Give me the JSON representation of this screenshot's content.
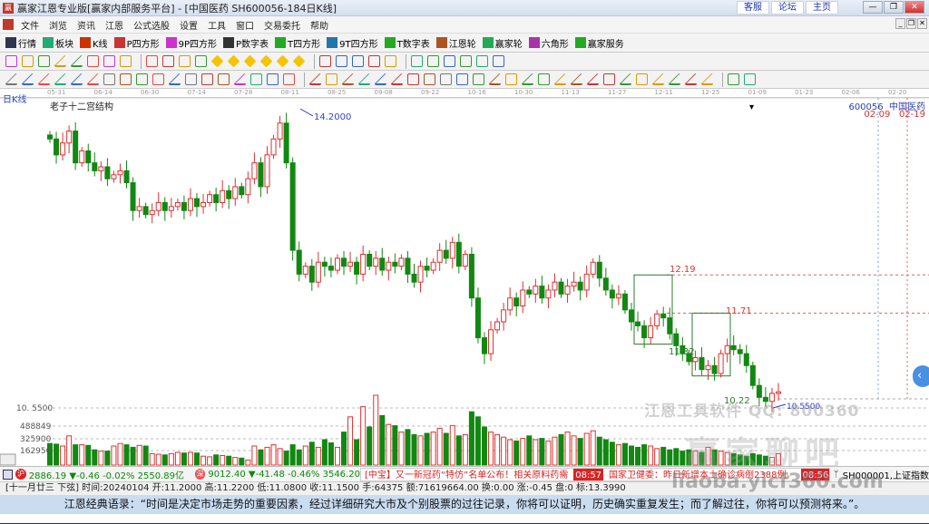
{
  "window": {
    "title": "赢家江恩专业版[赢家内部服务平台] - [中国医药  SH600056-184日K线]",
    "links": [
      "客服",
      "论坛",
      "主页"
    ],
    "controls": [
      "—",
      "❐",
      "✕"
    ]
  },
  "menu": [
    "文件",
    "浏览",
    "资讯",
    "江恩",
    "公式选股",
    "设置",
    "工具",
    "窗口",
    "交易委托",
    "帮助"
  ],
  "toolbar1": [
    {
      "label": "行情",
      "icon": "market-icon",
      "color": "#335"
    },
    {
      "label": "板块",
      "icon": "sector-icon",
      "color": "#2a7"
    },
    {
      "label": "K线",
      "icon": "kline-icon",
      "color": "#c30"
    },
    {
      "label": "P四方形",
      "icon": "ps-icon",
      "color": "#c33"
    },
    {
      "label": "9P四方形",
      "icon": "p9-icon",
      "color": "#c3c"
    },
    {
      "label": "P数字表",
      "icon": "pn-icon",
      "color": "#333"
    },
    {
      "label": "T四方形",
      "icon": "ts-icon",
      "color": "#2a2"
    },
    {
      "label": "9T四方形",
      "icon": "t9-icon",
      "color": "#27a"
    },
    {
      "label": "T数字表",
      "icon": "tn-icon",
      "color": "#2a2"
    },
    {
      "label": "江恩轮",
      "icon": "gann-wheel-icon",
      "color": "#a52"
    },
    {
      "label": "赢家轮",
      "icon": "winner-wheel-icon",
      "color": "#2a5"
    },
    {
      "label": "六角形",
      "icon": "hexagon-icon",
      "color": "#a3a"
    },
    {
      "label": "赢家服务",
      "icon": "dollar-icon",
      "color": "#2a2"
    }
  ],
  "toolbar2_icons": [
    "period-icon",
    "zoom-icon",
    "info-icon",
    "kline-a-icon",
    "kline-b-icon",
    "split-icon",
    "rights-icon",
    "flag-icon",
    "first-icon",
    "last-icon",
    "prev-icon",
    "next-icon",
    "diamond-1-icon",
    "diamond-2-icon",
    "diamond-3-icon",
    "diamond-4-icon",
    "diamond-5-icon",
    "diamond-6-icon",
    "hand-icon",
    "cross-icon",
    "va-icon",
    "gift-icon",
    "calc-icon",
    "calendar-icon",
    "calculator-icon",
    "notes-icon",
    "save-icon",
    "print-icon",
    "truck-icon"
  ],
  "toolbar3_icons": [
    "pen-icon",
    "lines-icon",
    "fan-1-icon",
    "fan-2-icon",
    "fan-3-icon",
    "fan-4-icon",
    "arc-icon",
    "circle-icon",
    "grid-icon",
    "n2-icon",
    "angle-icon",
    "target-icon",
    "star-icon",
    "square-icon",
    "gann-line-icon",
    "box-1-icon",
    "box-2-icon",
    "box-3-icon",
    "bars-icon",
    "rect-icon",
    "ray-icon",
    "fan-5-icon",
    "fan-6-icon",
    "angle-2-icon",
    "wave-icon",
    "grid-2-icon",
    "grid-3-icon",
    "parallel-icon",
    "bracket-icon",
    "percent-line-icon",
    "percent-icon",
    "level-1-icon",
    "coin-icon",
    "level-2-icon",
    "pencil-icon",
    "level-3-icon",
    "gold-icon",
    "angle-3-icon",
    "f-icon",
    "angle-4-icon",
    "angle-5-icon",
    "angle-6-icon",
    "angle-7-icon",
    "yinyang-icon",
    "infinity-icon"
  ],
  "chart": {
    "period_label": "日K线",
    "indicator_label": "老子十二宫结构",
    "dropdown": "▾",
    "stock_code": "600056",
    "stock_name": "中国医药",
    "marker_dates": [
      "02-09",
      "02-19"
    ],
    "date_ticks": [
      "05-31",
      "06-14",
      "06-30",
      "07-14",
      "07-28",
      "08-11",
      "08-25",
      "09-08",
      "09-22",
      "10-16",
      "10-30",
      "11-13",
      "11-27",
      "12-11",
      "12-25",
      "01-09",
      "01-23",
      "02-06",
      "02-20"
    ],
    "high_label": "14.2000",
    "low_label": "10.5500",
    "axis_price_label": "10. 5500",
    "levels": [
      "12.19",
      "11.71",
      "11.32",
      "10.22"
    ],
    "volume_ticks": [
      "488849",
      "325900",
      "162950"
    ],
    "colors": {
      "up": "#e03030",
      "down": "#118811"
    },
    "closes": [
      13.9,
      13.7,
      13.85,
      14.0,
      13.6,
      13.75,
      13.6,
      13.5,
      13.55,
      13.4,
      13.45,
      13.5,
      13.35,
      13.0,
      13.05,
      12.95,
      13.0,
      13.1,
      13.0,
      13.05,
      13.1,
      13.0,
      13.15,
      13.05,
      13.1,
      13.2,
      13.1,
      13.25,
      13.15,
      13.3,
      13.2,
      13.4,
      13.6,
      13.3,
      13.7,
      13.9,
      14.1,
      13.6,
      12.5,
      12.2,
      12.3,
      12.1,
      12.35,
      12.3,
      12.25,
      12.4,
      12.3,
      12.35,
      12.2,
      12.45,
      12.3,
      12.4,
      12.25,
      12.35,
      12.3,
      12.4,
      12.2,
      12.1,
      12.3,
      12.25,
      12.35,
      12.5,
      12.4,
      12.6,
      12.3,
      12.45,
      11.9,
      11.4,
      11.2,
      11.5,
      11.6,
      11.75,
      11.9,
      11.8,
      12.0,
      11.95,
      12.05,
      11.9,
      12.0,
      12.1,
      11.95,
      12.05,
      12.1,
      12.0,
      12.2,
      12.35,
      12.15,
      12.0,
      11.9,
      11.95,
      11.75,
      11.6,
      11.55,
      11.4,
      11.55,
      11.7,
      11.65,
      11.45,
      11.3,
      11.2,
      11.1,
      11.15,
      11.0,
      11.05,
      10.95,
      11.2,
      11.3,
      11.25,
      11.2,
      11.05,
      10.8,
      10.65,
      10.6,
      10.7,
      10.72
    ],
    "volumes": [
      170,
      165,
      150,
      230,
      160,
      160,
      155,
      120,
      110,
      110,
      150,
      170,
      160,
      140,
      155,
      150,
      90,
      85,
      80,
      90,
      100,
      95,
      100,
      95,
      70,
      65,
      80,
      75,
      70,
      60,
      55,
      40,
      150,
      120,
      140,
      160,
      130,
      110,
      160,
      120,
      150,
      180,
      140,
      200,
      175,
      140,
      260,
      380,
      200,
      460,
      300,
      550,
      390,
      320,
      310,
      260,
      280,
      240,
      230,
      250,
      260,
      290,
      250,
      310,
      230,
      240,
      420,
      380,
      300,
      260,
      240,
      220,
      200,
      190,
      210,
      230,
      200,
      210,
      190,
      220,
      240,
      260,
      230,
      210,
      250,
      270,
      220,
      200,
      180,
      160,
      170,
      150,
      140,
      160,
      150,
      130,
      140,
      120,
      130,
      110,
      120,
      110,
      100,
      140,
      120,
      110,
      100,
      90,
      80,
      70,
      90,
      80,
      70,
      60,
      90
    ]
  },
  "watermarks": [
    "江恩工具软件  QQ:  800360",
    "赢家聊吧",
    "liaoba.yicf360.com"
  ],
  "ticker": {
    "sh_value": "2886.19",
    "sh_change": "▼-0.46",
    "sh_pct": "-0.02%",
    "sh_amount": "2550.89亿",
    "sz_value": "9012.40",
    "sz_change": "▼-41.48",
    "sz_pct": "-0.46%",
    "sz_amount": "3546.20",
    "news": [
      "[中宝】又一新冠药“特仿”名单公布！相关原料药需",
      "国家卫健委：昨日新增本土确诊病例2388例。"
    ],
    "news_times": [
      "08:57",
      "08:56"
    ],
    "index": "SH000001,上证指数"
  },
  "status": "[十一月廿三  下弦] 时间:20240104 开:11.2000 高:11.2200 低:11.0800 收:11.1500 手:64375 额:71619664.00 换:0.00 涨:-0.45 盘:0 标:13.3990",
  "quote": "江恩经典语录：“时间是决定市场走势的重要因素，经过详细研究大市及个别股票的过往记录，你将可以证明，历史确实重复发生；而了解过往，你将可以预测将来。”。"
}
